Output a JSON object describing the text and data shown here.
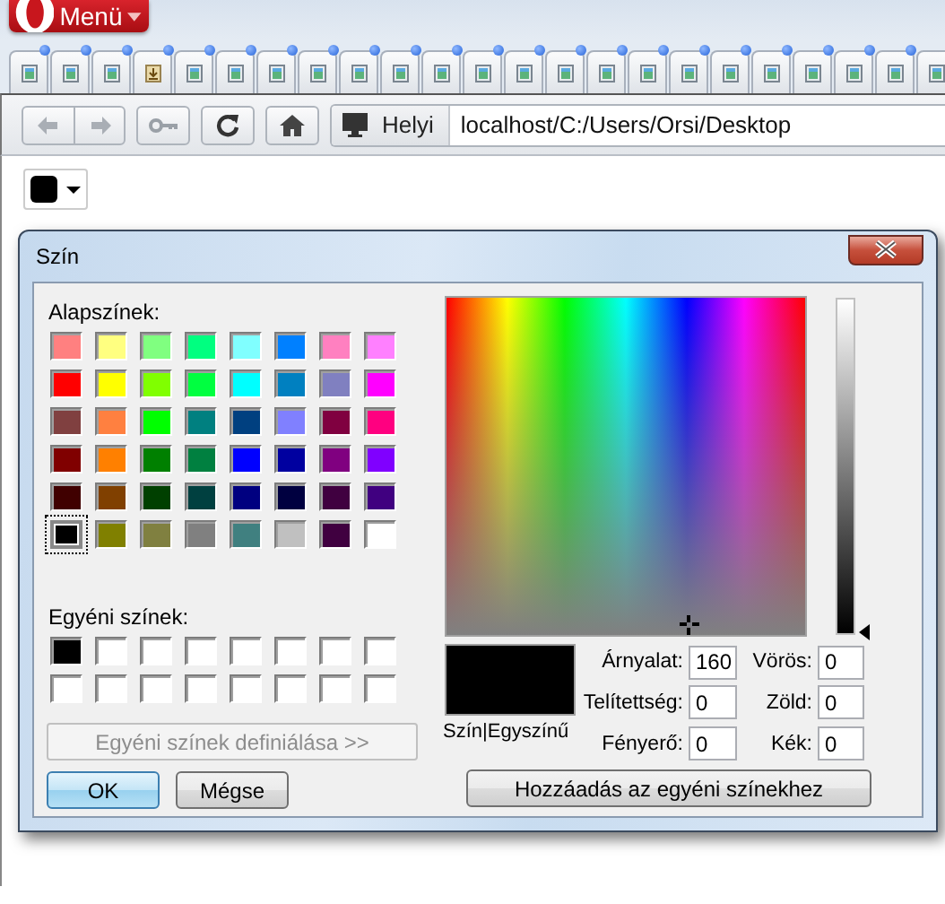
{
  "menu_button": {
    "label": "Menü"
  },
  "tabs": [
    {
      "kind": "page"
    },
    {
      "kind": "page"
    },
    {
      "kind": "page"
    },
    {
      "kind": "download"
    },
    {
      "kind": "page"
    },
    {
      "kind": "page"
    },
    {
      "kind": "page"
    },
    {
      "kind": "page"
    },
    {
      "kind": "page"
    },
    {
      "kind": "page"
    },
    {
      "kind": "page"
    },
    {
      "kind": "page"
    },
    {
      "kind": "page"
    },
    {
      "kind": "page"
    },
    {
      "kind": "page"
    },
    {
      "kind": "page"
    },
    {
      "kind": "page"
    },
    {
      "kind": "page"
    },
    {
      "kind": "page"
    },
    {
      "kind": "page"
    },
    {
      "kind": "page"
    },
    {
      "kind": "page"
    },
    {
      "kind": "page"
    }
  ],
  "toolbar": {
    "back": {
      "disabled": true
    },
    "forward": {
      "disabled": true
    },
    "site_badge": "Helyi",
    "url": "localhost/C:/Users/Orsi/Desktop"
  },
  "color_picker_button": {
    "color": "#000000"
  },
  "dialog": {
    "title": "Szín",
    "basic_label": "Alapszínek:",
    "basic_colors": [
      {
        "color": "#ff8080",
        "selected": false
      },
      {
        "color": "#ffff80",
        "selected": false
      },
      {
        "color": "#80ff80",
        "selected": false
      },
      {
        "color": "#00ff80",
        "selected": false
      },
      {
        "color": "#80ffff",
        "selected": false
      },
      {
        "color": "#0080ff",
        "selected": false
      },
      {
        "color": "#ff80c0",
        "selected": false
      },
      {
        "color": "#ff80ff",
        "selected": false
      },
      {
        "color": "#ff0000",
        "selected": false
      },
      {
        "color": "#ffff00",
        "selected": false
      },
      {
        "color": "#80ff00",
        "selected": false
      },
      {
        "color": "#00ff40",
        "selected": false
      },
      {
        "color": "#00ffff",
        "selected": false
      },
      {
        "color": "#0080c0",
        "selected": false
      },
      {
        "color": "#8080c0",
        "selected": false
      },
      {
        "color": "#ff00ff",
        "selected": false
      },
      {
        "color": "#804040",
        "selected": false
      },
      {
        "color": "#ff8040",
        "selected": false
      },
      {
        "color": "#00ff00",
        "selected": false
      },
      {
        "color": "#008080",
        "selected": false
      },
      {
        "color": "#004080",
        "selected": false
      },
      {
        "color": "#8080ff",
        "selected": false
      },
      {
        "color": "#800040",
        "selected": false
      },
      {
        "color": "#ff0080",
        "selected": false
      },
      {
        "color": "#800000",
        "selected": false
      },
      {
        "color": "#ff8000",
        "selected": false
      },
      {
        "color": "#008000",
        "selected": false
      },
      {
        "color": "#008040",
        "selected": false
      },
      {
        "color": "#0000ff",
        "selected": false
      },
      {
        "color": "#0000a0",
        "selected": false
      },
      {
        "color": "#800080",
        "selected": false
      },
      {
        "color": "#8000ff",
        "selected": false
      },
      {
        "color": "#400000",
        "selected": false
      },
      {
        "color": "#804000",
        "selected": false
      },
      {
        "color": "#004000",
        "selected": false
      },
      {
        "color": "#004040",
        "selected": false
      },
      {
        "color": "#000080",
        "selected": false
      },
      {
        "color": "#000040",
        "selected": false
      },
      {
        "color": "#400040",
        "selected": false
      },
      {
        "color": "#400080",
        "selected": false
      },
      {
        "color": "#000000",
        "selected": true
      },
      {
        "color": "#808000",
        "selected": false
      },
      {
        "color": "#808040",
        "selected": false
      },
      {
        "color": "#808080",
        "selected": false
      },
      {
        "color": "#408080",
        "selected": false
      },
      {
        "color": "#c0c0c0",
        "selected": false
      },
      {
        "color": "#400040",
        "selected": false
      },
      {
        "color": "#ffffff",
        "selected": false
      }
    ],
    "custom_label": "Egyéni színek:",
    "custom_colors": [
      {
        "color": "#000000"
      },
      {
        "color": "#ffffff"
      },
      {
        "color": "#ffffff"
      },
      {
        "color": "#ffffff"
      },
      {
        "color": "#ffffff"
      },
      {
        "color": "#ffffff"
      },
      {
        "color": "#ffffff"
      },
      {
        "color": "#ffffff"
      },
      {
        "color": "#ffffff"
      },
      {
        "color": "#ffffff"
      },
      {
        "color": "#ffffff"
      },
      {
        "color": "#ffffff"
      },
      {
        "color": "#ffffff"
      },
      {
        "color": "#ffffff"
      },
      {
        "color": "#ffffff"
      },
      {
        "color": "#ffffff"
      }
    ],
    "define_button": {
      "label": "Egyéni színek definiálása >>",
      "disabled": true
    },
    "ok_button": "OK",
    "cancel_button": "Mégse",
    "luminance": {
      "level": 0
    },
    "preview": {
      "color": "#000000"
    },
    "preview_label": "Szín|Egyszínű",
    "fields": [
      {
        "label": "Árnyalat:",
        "value": "160"
      },
      {
        "label": "Vörös:",
        "value": "0"
      },
      {
        "label": "Telítettség:",
        "value": "0"
      },
      {
        "label": "Zöld:",
        "value": "0"
      },
      {
        "label": "Fényerő:",
        "value": "0"
      },
      {
        "label": "Kék:",
        "value": "0"
      }
    ],
    "add_button": "Hozzáadás az egyéni színekhez"
  }
}
